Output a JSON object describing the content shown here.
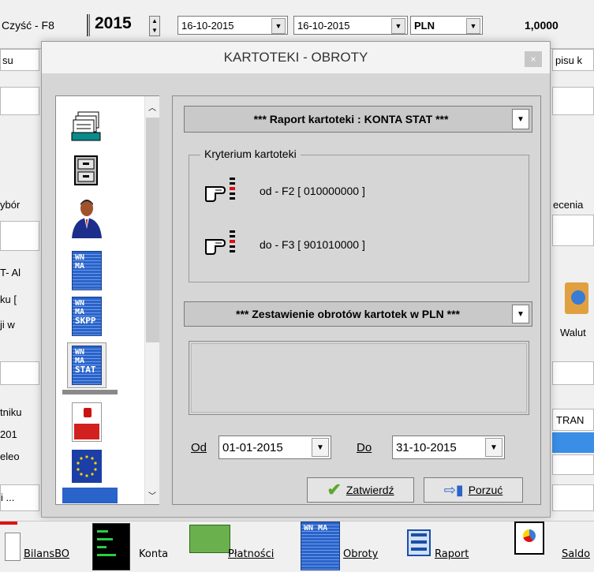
{
  "toolbar": {
    "clear_label": "Czyść - F8",
    "year": "2015",
    "date_from": "16-10-2015",
    "date_to": "16-10-2015",
    "currency": "PLN",
    "rate": "1,0000"
  },
  "background": {
    "frag_su": "su",
    "frag_pisu": "pisu k",
    "frag_wybor": "ybór",
    "frag_ecenia": "ecenia",
    "frag_tal": "T- Al",
    "frag_ku": "ku [",
    "frag_jiw": "ji w",
    "frag_waluta": "Walut",
    "frag_tniku": "tniku",
    "frag_201": "201",
    "frag_eleo": "eleo",
    "frag_dots": "i ...",
    "frag_tran": "TRAN"
  },
  "dialog": {
    "title": "KARTOTEKI - OBROTY",
    "close_glyph": "×",
    "report_select": "*** Raport kartoteki : KONTA STAT ***",
    "criteria_group": "Kryterium kartoteki",
    "from_label": "od - F2 [ 010000000 ]",
    "to_label": "do - F3 [ 901010000 ]",
    "summary_select": "*** Zestawienie obrotów kartotek w PLN ***",
    "od_label": "Od",
    "od_value": "01-01-2015",
    "do_label": "Do",
    "do_value": "31-10-2015",
    "confirm_label": "Zatwierdź",
    "cancel_label": "Porzuć",
    "list_icons": [
      "cardfile-icon",
      "cabinet-icon",
      "person-icon",
      "ledger-wn-ma-icon",
      "ledger-skpp-icon",
      "ledger-stat-icon",
      "poland-flag-icon",
      "eu-flag-icon"
    ],
    "ledger_wnma": "WN MA",
    "ledger_skpp": "SKPP",
    "ledger_stat": "STAT"
  },
  "bottombar": {
    "items": [
      "BilansBO",
      "Konta",
      "Płatności",
      "Obroty",
      "Raport",
      "Saldo"
    ]
  },
  "colors": {
    "dialog_bg": "#d6d6d6",
    "ledger_blue": "#2a63c9",
    "selection_blue": "#3a8ee6"
  }
}
